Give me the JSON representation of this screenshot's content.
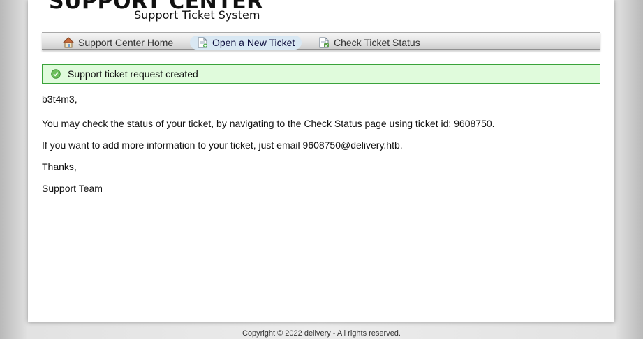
{
  "header": {
    "logo_main": "SUPPORT CENTER",
    "logo_sub": "Support Ticket System"
  },
  "nav": {
    "items": [
      {
        "label": "Support Center Home",
        "icon": "home-icon"
      },
      {
        "label": "Open a New Ticket",
        "icon": "new-ticket-icon",
        "active": true
      },
      {
        "label": "Check Ticket Status",
        "icon": "ticket-status-icon"
      }
    ]
  },
  "notice": {
    "text": "Support ticket request created",
    "icon": "check-icon",
    "color": "#3aa33a",
    "background": "#e0fbdc"
  },
  "message": {
    "greeting": "b3t4m3,",
    "status_line": "You may check the status of your ticket, by navigating to the Check Status page using ticket id: 9608750.",
    "email_line": "If you want to add more information to your ticket, just email 9608750@delivery.htb.",
    "thanks": "Thanks,",
    "signature": "Support Team"
  },
  "footer": {
    "copyright": "Copyright © 2022 delivery - All rights reserved."
  }
}
